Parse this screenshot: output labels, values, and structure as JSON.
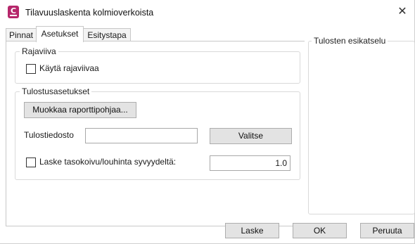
{
  "window": {
    "title": "Tilavuuslaskenta kolmioverkoista",
    "close_glyph": "✕"
  },
  "tabs": [
    {
      "label": "Pinnat"
    },
    {
      "label": "Asetukset",
      "active": true
    },
    {
      "label": "Esitystapa"
    }
  ],
  "rajaviiva": {
    "group_label": "Rajaviiva",
    "checkbox_label": "Käytä rajaviivaa",
    "checked": false
  },
  "tulostus": {
    "group_label": "Tulostusasetukset",
    "edit_template_button": "Muokkaa raporttipohjaa...",
    "output_file_label": "Tulostiedosto",
    "output_file_value": "",
    "choose_button": "Valitse",
    "depth_checkbox_label": "Laske tasokoivu/louhinta syvyydeltä:",
    "depth_checked": false,
    "depth_value": "1.0"
  },
  "preview": {
    "group_label": "Tulosten esikatselu"
  },
  "footer": {
    "compute_button": "Laske",
    "ok_button": "OK",
    "cancel_button": "Peruuta"
  },
  "colors": {
    "app_icon": "#b6276b",
    "button_bg": "#e3e3e3",
    "border": "#adadad"
  }
}
